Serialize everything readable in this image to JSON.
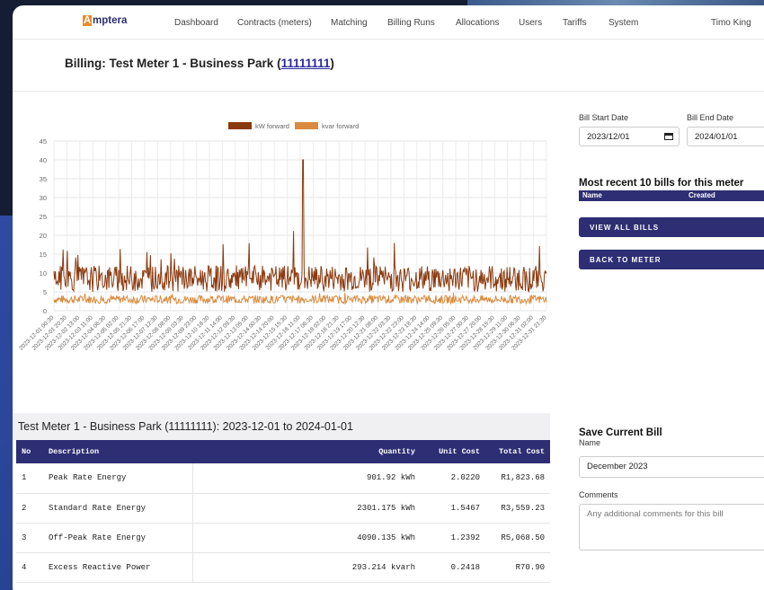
{
  "nav": {
    "logo_letter": "A",
    "logo_rest": "mptera",
    "items": [
      "Dashboard",
      "Contracts (meters)",
      "Matching",
      "Billing Runs",
      "Allocations",
      "Users",
      "Tariffs",
      "System"
    ],
    "user": "Timo King"
  },
  "header": {
    "title_prefix": "Billing: Test Meter 1 - Business Park (",
    "meter_link": "11111111",
    "title_suffix": ")"
  },
  "chart_data": {
    "type": "line",
    "series": [
      {
        "name": "kW forward",
        "color": "#8b3a0f",
        "mean": 8.5,
        "spike_at": 0.506,
        "spike_value": 40
      },
      {
        "name": "kvar forward",
        "color": "#d98a3e",
        "mean": 3.0
      }
    ],
    "ylim": [
      0,
      45
    ],
    "yticks": [
      0,
      5,
      10,
      15,
      20,
      25,
      30,
      35,
      40,
      45
    ],
    "x_tick_labels": [
      "2023-12-01 00:30",
      "2023-12-01 20:30",
      "2023-12-02 13:00",
      "2023-12-03 11:00",
      "2023-12-04 06:30",
      "2023-12-05 02:00",
      "2023-12-05 21:30",
      "2023-12-06 17:00",
      "2023-12-07 12:30",
      "2023-12-08 08:00",
      "2023-12-09 03:30",
      "2023-12-09 23:00",
      "2023-12-10 18:30",
      "2023-12-11 14:00",
      "2023-12-12 09:30",
      "2023-12-13 05:00",
      "2023-12-14 00:30",
      "2023-12-14 20:00",
      "2023-12-15 15:30",
      "2023-12-16 11:00",
      "2023-12-17 06:30",
      "2023-12-18 02:00",
      "2023-12-18 21:30",
      "2023-12-19 17:00",
      "2023-12-20 12:30",
      "2023-12-21 08:00",
      "2023-12-22 03:30",
      "2023-12-22 23:00",
      "2023-12-23 18:30",
      "2023-12-24 14:00",
      "2023-12-25 09:30",
      "2023-12-26 05:00",
      "2023-12-27 00:30",
      "2023-12-27 20:00",
      "2023-12-28 15:30",
      "2023-12-29 11:00",
      "2023-12-30 06:30",
      "2023-12-31 02:00",
      "2023-12-31 21:30"
    ],
    "grid": true,
    "legend": "top-center"
  },
  "bill_dates": {
    "start_label": "Bill Start Date",
    "start_value": "2023/12/01",
    "end_label": "Bill End Date",
    "end_value": "2024/01/01"
  },
  "recent_bills": {
    "title": "Most recent 10 bills for this meter",
    "col_name": "Name",
    "col_created": "Created"
  },
  "buttons": {
    "view_all": "VIEW ALL BILLS",
    "back": "BACK TO METER"
  },
  "table": {
    "title": "Test Meter 1 - Business Park (11111111): 2023-12-01 to 2024-01-01",
    "headers": [
      "No",
      "Description",
      "Quantity",
      "Unit Cost",
      "Total Cost"
    ],
    "rows": [
      [
        "1",
        "Peak Rate Energy",
        "901.92 kWh",
        "2.0220",
        "R1,823.68"
      ],
      [
        "2",
        "Standard Rate Energy",
        "2301.175 kWh",
        "1.5467",
        "R3,559.23"
      ],
      [
        "3",
        "Off-Peak Rate Energy",
        "4090.135 kWh",
        "1.2392",
        "R5,068.50"
      ],
      [
        "4",
        "Excess Reactive Power",
        "293.214 kvarh",
        "0.2418",
        "R70.90"
      ]
    ]
  },
  "save_bill": {
    "title": "Save Current Bill",
    "name_label": "Name",
    "name_value": "December 2023",
    "comments_label": "Comments",
    "comments_placeholder": "Any additional comments for this bill"
  }
}
